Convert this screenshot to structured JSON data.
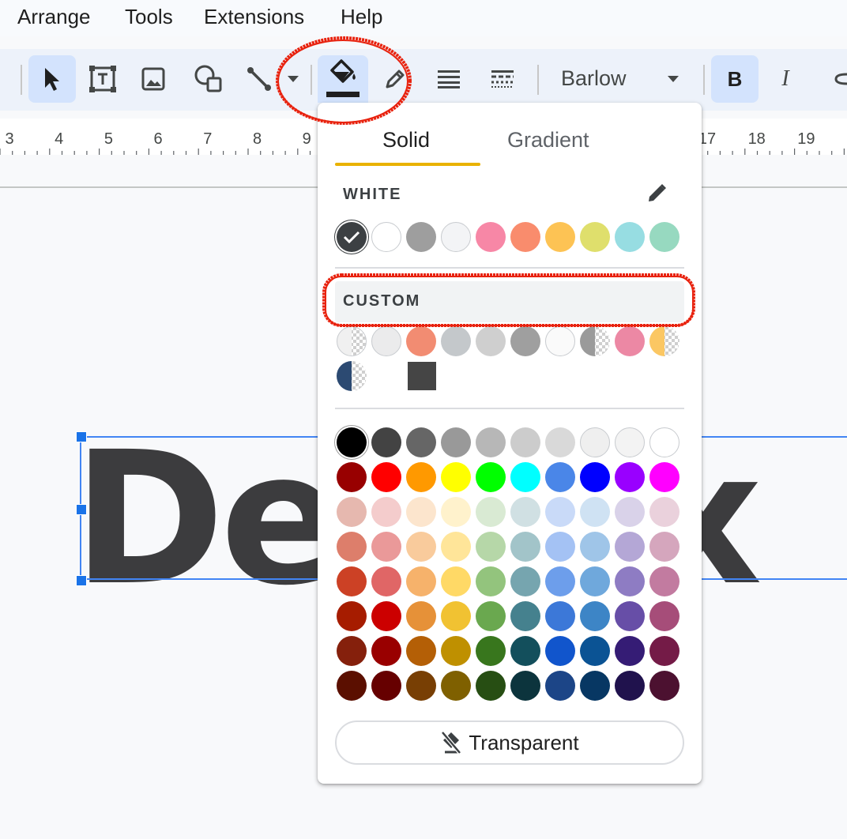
{
  "menu": [
    "Arrange",
    "Tools",
    "Extensions",
    "Help"
  ],
  "toolbar": {
    "font_name": "Barlow",
    "bold_label": "B",
    "italic_label": "I",
    "tools": [
      "select-tool",
      "text-box-tool",
      "image-tool",
      "shape-tool",
      "line-tool",
      "fill-color-tool",
      "border-color-tool",
      "border-weight-tool",
      "border-dash-tool"
    ]
  },
  "ruler": {
    "ticks": [
      "3",
      "4",
      "5",
      "6",
      "7",
      "8",
      "9",
      "17",
      "18",
      "19"
    ]
  },
  "slide": {
    "visible_text": "Den ex"
  },
  "color_popup": {
    "tabs": [
      "Solid",
      "Gradient"
    ],
    "selected_tab": "Solid",
    "theme_label": "WHITE",
    "theme_colors": [
      "#3c4043",
      "#ffffff",
      "#9e9e9e",
      "#f3f4f6",
      "#f787a6",
      "#f98c6d",
      "#fdc354",
      "#dfdf6c",
      "#97dde2",
      "#97d9c0"
    ],
    "theme_selected_index": 0,
    "custom_label": "CUSTOM",
    "custom_colors": [
      "#f0f0f0",
      "#ebebec",
      "#f28c72",
      "#c4c8cb",
      "#cfcfcf",
      "#9f9f9f",
      "#fafafa",
      "#9a9a9a",
      "#ec88a4",
      "#fbc763",
      "#2c4a72",
      "#454545"
    ],
    "standard_colors": [
      [
        "#000000",
        "#434343",
        "#666666",
        "#999999",
        "#b7b7b7",
        "#cccccc",
        "#d9d9d9",
        "#efefef",
        "#f3f3f3",
        "#ffffff"
      ],
      [
        "#980000",
        "#ff0000",
        "#ff9900",
        "#ffff00",
        "#00ff00",
        "#00ffff",
        "#4a86e8",
        "#0000ff",
        "#9900ff",
        "#ff00ff"
      ],
      [
        "#e6b8af",
        "#f4cccc",
        "#fce5cd",
        "#fff2cc",
        "#d9ead3",
        "#d0e0e3",
        "#c9daf8",
        "#cfe2f3",
        "#d9d2e9",
        "#ead1dc"
      ],
      [
        "#dd7e6b",
        "#ea9999",
        "#f9cb9c",
        "#ffe599",
        "#b6d7a8",
        "#a2c4c9",
        "#a4c2f4",
        "#9fc5e8",
        "#b4a7d6",
        "#d5a6bd"
      ],
      [
        "#cc4125",
        "#e06666",
        "#f6b26b",
        "#ffd966",
        "#93c47d",
        "#76a5af",
        "#6d9eeb",
        "#6fa8dc",
        "#8e7cc3",
        "#c27ba0"
      ],
      [
        "#a61c00",
        "#cc0000",
        "#e69138",
        "#f1c232",
        "#6aa84f",
        "#45818e",
        "#3c78d8",
        "#3d85c6",
        "#674ea7",
        "#a64d79"
      ],
      [
        "#85200c",
        "#990000",
        "#b45f06",
        "#bf9000",
        "#38761d",
        "#134f5c",
        "#1155cc",
        "#0b5394",
        "#351c75",
        "#741b47"
      ],
      [
        "#5b0f00",
        "#660000",
        "#783f04",
        "#7f6000",
        "#274e13",
        "#0c343d",
        "#1c4587",
        "#073763",
        "#20124d",
        "#4c1130"
      ]
    ],
    "transparent_label": "Transparent"
  },
  "colors": {
    "accent": "#e9b200",
    "annotation": "#e8220e",
    "selection": "#1a73e8",
    "toolbar_active": "#d3e3fd"
  }
}
